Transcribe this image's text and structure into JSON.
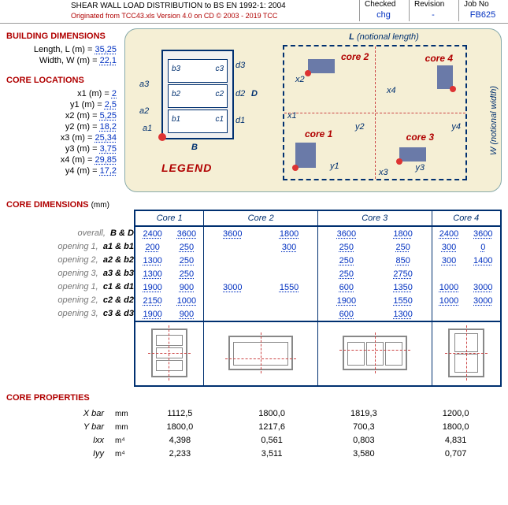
{
  "header": {
    "title": "SHEAR WALL LOAD DISTRIBUTION to BS EN 1992-1: 2004",
    "origin": "Originated from TCC43.xls Version 4.0 on CD © 2003 - 2019 TCC",
    "checked_lbl": "Checked",
    "checked_val": "chg",
    "revision_lbl": "Revision",
    "revision_val": "-",
    "jobno_lbl": "Job No",
    "jobno_val": "FB625"
  },
  "sections": {
    "building_dimensions": "BUILDING DIMENSIONS",
    "core_locations": "CORE LOCATIONS",
    "core_dimensions": "CORE DIMENSIONS",
    "core_dimensions_unit": "(mm)",
    "core_properties": "CORE PROPERTIES"
  },
  "building": {
    "length_lbl": "Length, L (m) =",
    "length": "35,25",
    "width_lbl": "Width, W (m) =",
    "width": "22,1"
  },
  "locations": {
    "x1_lbl": "x1 (m) =",
    "x1": "2",
    "y1_lbl": "y1 (m) =",
    "y1": "2,5",
    "x2_lbl": "x2 (m) =",
    "x2": "5,25",
    "y2_lbl": "y2 (m) =",
    "y2": "18,2",
    "x3_lbl": "x3 (m) =",
    "x3": "25,34",
    "y3_lbl": "y3 (m) =",
    "y3": "3,75",
    "x4_lbl": "x4 (m) =",
    "x4": "29,85",
    "y4_lbl": "y4 (m) =",
    "y4": "17,2"
  },
  "legend": {
    "L": "L",
    "notional_length": "(notional length)",
    "W_notional": "W (notional width)",
    "core1": "core 1",
    "core2": "core 2",
    "core3": "core 3",
    "core4": "core 4",
    "x1": "x1",
    "x2": "x2",
    "x3": "x3",
    "x4": "x4",
    "y1": "y1",
    "y2": "y2",
    "y3": "y3",
    "y4": "y4",
    "a1": "a1",
    "a2": "a2",
    "a3": "a3",
    "b1": "b1",
    "b2": "b2",
    "b3": "b3",
    "c1": "c1",
    "c2": "c2",
    "c3": "c3",
    "d1": "d1",
    "d2": "d2",
    "d3": "d3",
    "B": "B",
    "D": "D",
    "legend_text": "LEGEND"
  },
  "dim_rows": {
    "overall_it": "overall,",
    "overall_b": "B & D",
    "op1_it": "opening 1,",
    "op1_b": "a1 & b1",
    "op2_it": "opening 2,",
    "op2_b": "a2 & b2",
    "op3_it": "opening 3,",
    "op3_b": "a3 & b3",
    "oc1_it": "opening 1,",
    "oc1_b": "c1 & d1",
    "oc2_it": "opening 2,",
    "oc2_b": "c2 & d2",
    "oc3_it": "opening 3,",
    "oc3_b": "c3 & d3"
  },
  "core_headers": {
    "c1": "Core 1",
    "c2": "Core 2",
    "c3": "Core 3",
    "c4": "Core 4"
  },
  "core_vals": {
    "c1": [
      [
        "2400",
        "3600"
      ],
      [
        "200",
        "250"
      ],
      [
        "1300",
        "250"
      ],
      [
        "1300",
        "250"
      ],
      [
        "1900",
        "900"
      ],
      [
        "2150",
        "1000"
      ],
      [
        "1900",
        "900"
      ]
    ],
    "c2": [
      [
        "3600",
        "1800"
      ],
      [
        "",
        "300"
      ],
      [
        "",
        ""
      ],
      [
        "",
        ""
      ],
      [
        "3000",
        "1550"
      ],
      [
        "",
        ""
      ],
      [
        "",
        ""
      ]
    ],
    "c3": [
      [
        "3600",
        "1800"
      ],
      [
        "250",
        "250"
      ],
      [
        "250",
        "850"
      ],
      [
        "250",
        "2750"
      ],
      [
        "600",
        "1350"
      ],
      [
        "1900",
        "1550"
      ],
      [
        "600",
        "1300"
      ]
    ],
    "c4": [
      [
        "2400",
        "3600"
      ],
      [
        "300",
        "0"
      ],
      [
        "300",
        "1400"
      ],
      [
        "",
        ""
      ],
      [
        "1000",
        "3000"
      ],
      [
        "1000",
        "3000"
      ],
      [
        "",
        ""
      ]
    ]
  },
  "props": {
    "rows": [
      {
        "lbl": "X bar",
        "unit": "mm",
        "v": [
          "1112,5",
          "1800,0",
          "1819,3",
          "1200,0"
        ]
      },
      {
        "lbl": "Y bar",
        "unit": "mm",
        "v": [
          "1800,0",
          "1217,6",
          "700,3",
          "1800,0"
        ]
      },
      {
        "lbl": "Ixx",
        "unit": "m⁴",
        "v": [
          "4,398",
          "0,561",
          "0,803",
          "4,831"
        ]
      },
      {
        "lbl": "Iyy",
        "unit": "m⁴",
        "v": [
          "2,233",
          "3,511",
          "3,580",
          "0,707"
        ]
      }
    ]
  }
}
